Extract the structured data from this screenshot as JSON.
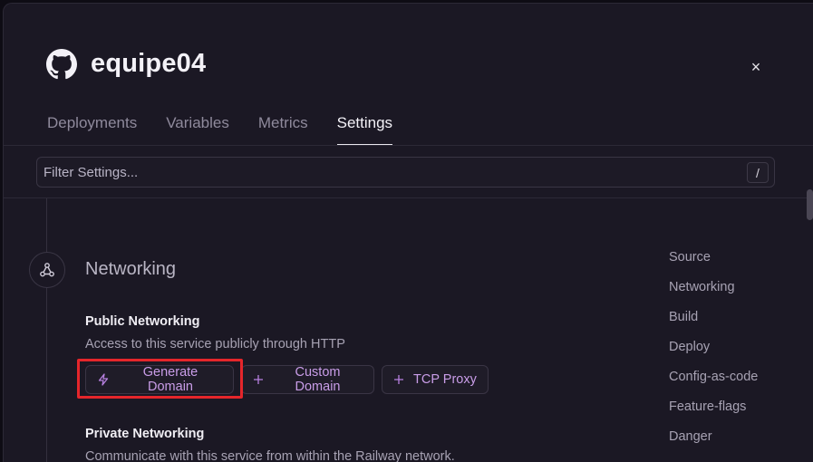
{
  "header": {
    "title": "equipe04",
    "icon": "github-icon",
    "close_label": "×"
  },
  "tabs": [
    {
      "label": "Deployments",
      "active": false
    },
    {
      "label": "Variables",
      "active": false
    },
    {
      "label": "Metrics",
      "active": false
    },
    {
      "label": "Settings",
      "active": true
    }
  ],
  "filter": {
    "placeholder": "Filter Settings...",
    "value": "",
    "shortcut": "/"
  },
  "section": {
    "icon": "network-nodes-icon",
    "title": "Networking",
    "public": {
      "title": "Public Networking",
      "description": "Access to this service publicly through HTTP",
      "buttons": [
        {
          "label": "Generate Domain",
          "icon": "lightning-icon"
        },
        {
          "label": "Custom Domain",
          "icon": "plus-icon"
        },
        {
          "label": "TCP Proxy",
          "icon": "plus-icon"
        }
      ]
    },
    "private": {
      "title": "Private Networking",
      "description": "Communicate with this service from within the Railway network."
    }
  },
  "side_nav": [
    "Source",
    "Networking",
    "Build",
    "Deploy",
    "Config-as-code",
    "Feature-flags",
    "Danger"
  ],
  "colors": {
    "accent": "#c99de8",
    "highlight": "#e5262b",
    "background": "#1b1824"
  }
}
